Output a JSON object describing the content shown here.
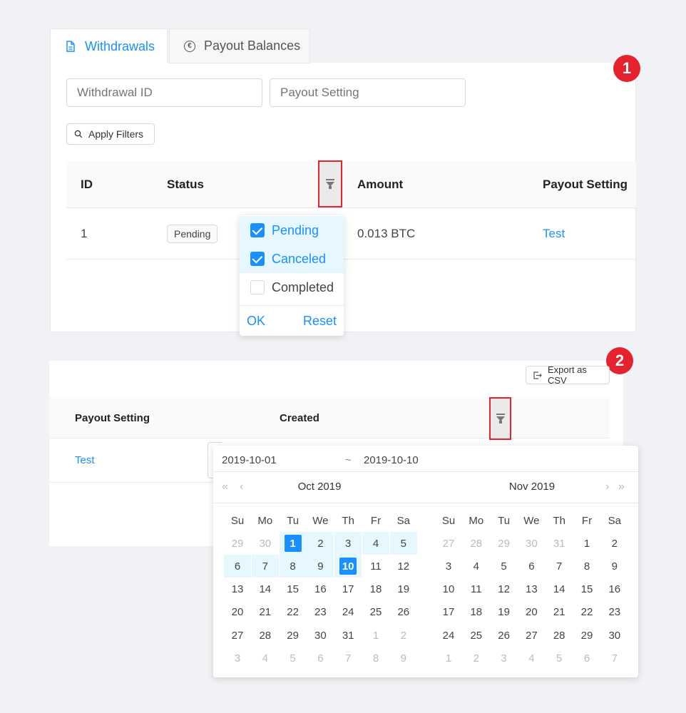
{
  "tabs": [
    {
      "label": "Withdrawals",
      "icon": "document-icon",
      "active": true
    },
    {
      "label": "Payout Balances",
      "icon": "euro-coin-icon",
      "active": false
    }
  ],
  "badges": [
    "1",
    "2"
  ],
  "filters": {
    "withdrawal_id_placeholder": "Withdrawal ID",
    "payout_setting_placeholder": "Payout Setting",
    "apply_label": "Apply Filters"
  },
  "table1": {
    "headers": [
      "ID",
      "Status",
      "Amount",
      "Payout Setting"
    ],
    "row": {
      "id": "1",
      "status": "Pending",
      "amount": "0.013 BTC",
      "payout_setting": "Test"
    }
  },
  "status_filter": {
    "options": [
      {
        "label": "Pending",
        "checked": true
      },
      {
        "label": "Canceled",
        "checked": true
      },
      {
        "label": "Completed",
        "checked": false
      }
    ],
    "ok_label": "OK",
    "reset_label": "Reset"
  },
  "panel2": {
    "export_label": "Export as CSV",
    "headers": [
      "Payout Setting",
      "Created"
    ],
    "row": {
      "payout_setting": "Test"
    }
  },
  "date_range": {
    "start": "2019-10-01",
    "separator": "~",
    "end": "2019-10-10",
    "left_month": "Oct 2019",
    "right_month": "Nov 2019",
    "weekdays": [
      "Su",
      "Mo",
      "Tu",
      "We",
      "Th",
      "Fr",
      "Sa"
    ],
    "left_days": [
      [
        "29",
        "30",
        "1",
        "2",
        "3",
        "4",
        "5"
      ],
      [
        "6",
        "7",
        "8",
        "9",
        "10",
        "11",
        "12"
      ],
      [
        "13",
        "14",
        "15",
        "16",
        "17",
        "18",
        "19"
      ],
      [
        "20",
        "21",
        "22",
        "23",
        "24",
        "25",
        "26"
      ],
      [
        "27",
        "28",
        "29",
        "30",
        "31",
        "1",
        "2"
      ],
      [
        "3",
        "4",
        "5",
        "6",
        "7",
        "8",
        "9"
      ]
    ],
    "right_days": [
      [
        "27",
        "28",
        "29",
        "30",
        "31",
        "1",
        "2"
      ],
      [
        "3",
        "4",
        "5",
        "6",
        "7",
        "8",
        "9"
      ],
      [
        "10",
        "11",
        "12",
        "13",
        "14",
        "15",
        "16"
      ],
      [
        "17",
        "18",
        "19",
        "20",
        "21",
        "22",
        "23"
      ],
      [
        "24",
        "25",
        "26",
        "27",
        "28",
        "29",
        "30"
      ],
      [
        "1",
        "2",
        "3",
        "4",
        "5",
        "6",
        "7"
      ]
    ],
    "selected_start_day": "1",
    "selected_end_day": "10"
  },
  "colors": {
    "accent": "#1890ff",
    "badge": "#e5232e",
    "range_bg": "#e6f7ff"
  }
}
